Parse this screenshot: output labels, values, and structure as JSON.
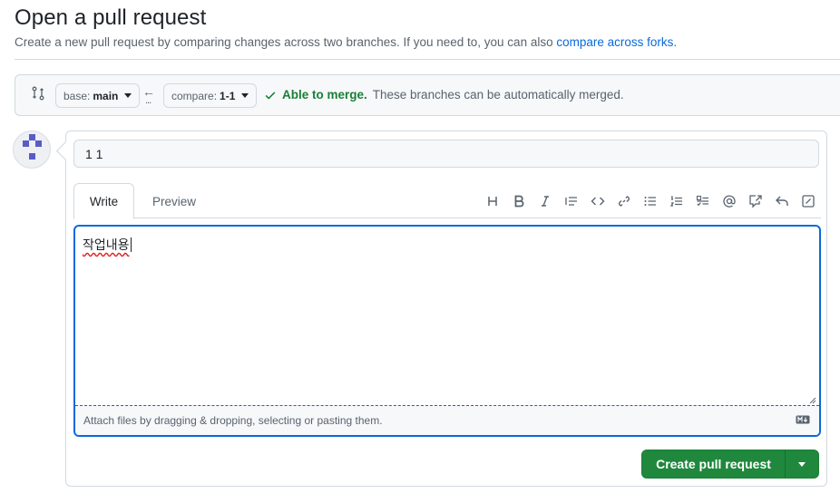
{
  "page": {
    "title": "Open a pull request",
    "subtitle_text": "Create a new pull request by comparing changes across two branches. If you need to, you can also ",
    "subtitle_link": "compare across forks",
    "subtitle_end": "."
  },
  "range": {
    "base_label": "base:",
    "base_value": "main",
    "compare_label": "compare:",
    "compare_value": "1-1",
    "merge_status": "Able to merge.",
    "merge_message": "These branches can be automatically merged."
  },
  "composer": {
    "title_value": "1 1",
    "tabs": [
      {
        "label": "Write",
        "active": true
      },
      {
        "label": "Preview",
        "active": false
      }
    ],
    "toolbar_icons": [
      "heading-icon",
      "bold-icon",
      "italic-icon",
      "quote-icon",
      "code-icon",
      "link-icon",
      "unordered-list-icon",
      "ordered-list-icon",
      "task-list-icon",
      "mention-icon",
      "reference-icon",
      "reply-icon",
      "fullscreen-icon"
    ],
    "body_text": "작업내용",
    "attach_hint": "Attach files by dragging & dropping, selecting or pasting them.",
    "submit_label": "Create pull request"
  },
  "colors": {
    "accent": "#0969da",
    "success": "#1a7f37",
    "button": "#1f883d",
    "avatar": "#5a5cc5"
  }
}
